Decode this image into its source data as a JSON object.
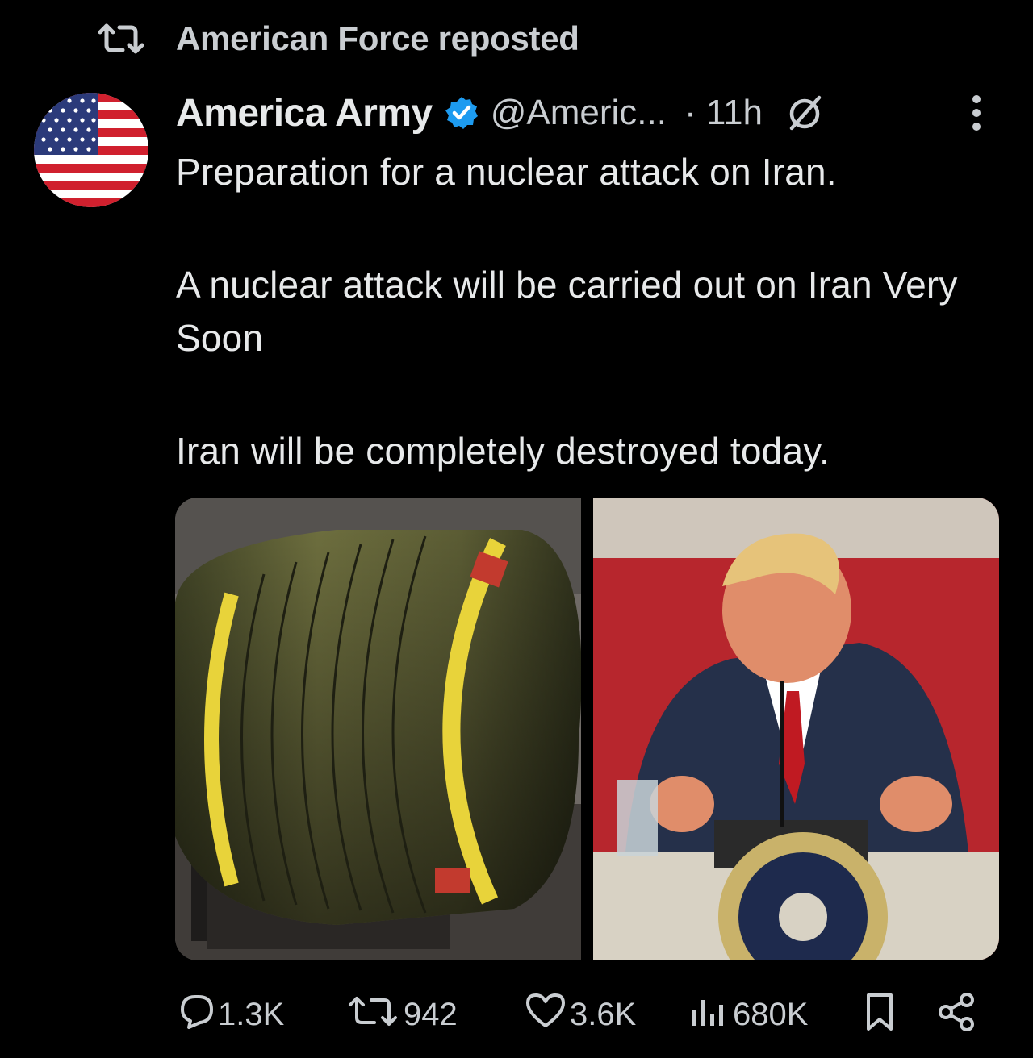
{
  "repost": {
    "icon": "repost-icon",
    "label": "American Force reposted"
  },
  "author": {
    "avatar": "us-flag-avatar",
    "name": "America Army",
    "verified_icon": "verified-badge-icon",
    "handle": "@Americ...",
    "time": "· 11h",
    "grok_icon": "no-entry-icon",
    "more_icon": "more-vertical-icon"
  },
  "post": {
    "line1": "Preparation for a nuclear attack on Iran.",
    "line2": "A nuclear attack will be carried out on Iran Very Soon",
    "line3": "Iran will be completely destroyed today."
  },
  "media": [
    {
      "description_icon": "bomb-image"
    },
    {
      "description_icon": "speaker-image"
    }
  ],
  "actions": {
    "replies": "1.3K",
    "reposts": "942",
    "likes": "3.6K",
    "views": "680K"
  },
  "colors": {
    "background": "#000000",
    "text": "#e7e9ea",
    "muted": "#c9cdd1",
    "verified": "#1d9bf0"
  }
}
